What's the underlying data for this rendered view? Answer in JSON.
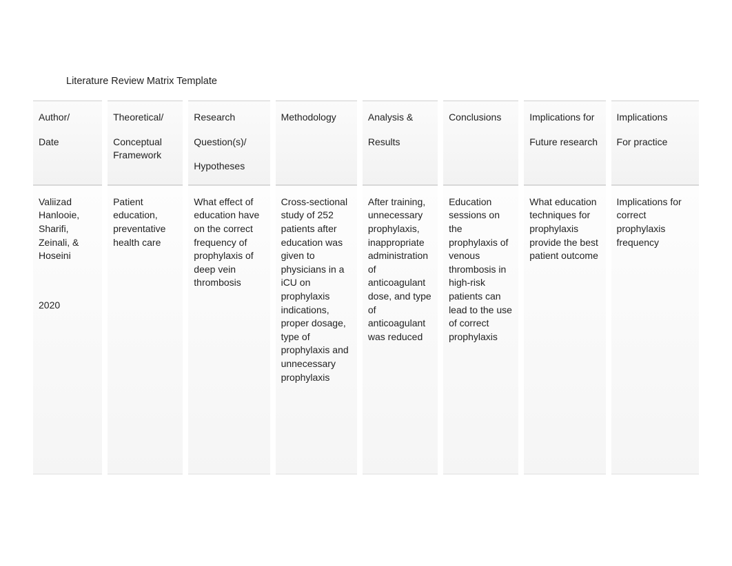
{
  "page": {
    "title": "Literature Review Matrix Template"
  },
  "headers": {
    "author_line1": "Author/",
    "author_line2": "Date",
    "framework_line1": "Theoretical/",
    "framework_line2": "Conceptual Framework",
    "question_line1": "Research",
    "question_line2": "Question(s)/",
    "question_line3": "Hypotheses",
    "methodology": "Methodology",
    "analysis_line1": "Analysis &",
    "analysis_line2": "Results",
    "conclusions": "Conclusions",
    "future_line1": "Implications for",
    "future_line2": "Future research",
    "practice_line1": "Implications",
    "practice_line2": "For practice"
  },
  "rows": [
    {
      "author": " Valiizad Hanlooie, Sharifi, Zeinali, & Hoseini",
      "date": "2020",
      "framework": " Patient education, preventative health care",
      "question": " What effect of education have on the correct frequency of prophylaxis of deep vein thrombosis",
      "methodology": "Cross-sectional study of 252 patients after education was given to physicians in a iCU on prophylaxis indications, proper dosage, type of prophylaxis and unnecessary prophylaxis",
      "analysis": " After training, unnecessary prophylaxis, inappropriate administration of anticoagulant dose, and type of anticoagulant was reduced",
      "conclusions": " Education sessions on the prophylaxis of venous thrombosis in high-risk patients can lead to the use of correct prophylaxis",
      "future": " What education techniques for prophylaxis provide the best patient outcome",
      "practice": " Implications for correct prophylaxis frequency"
    }
  ]
}
